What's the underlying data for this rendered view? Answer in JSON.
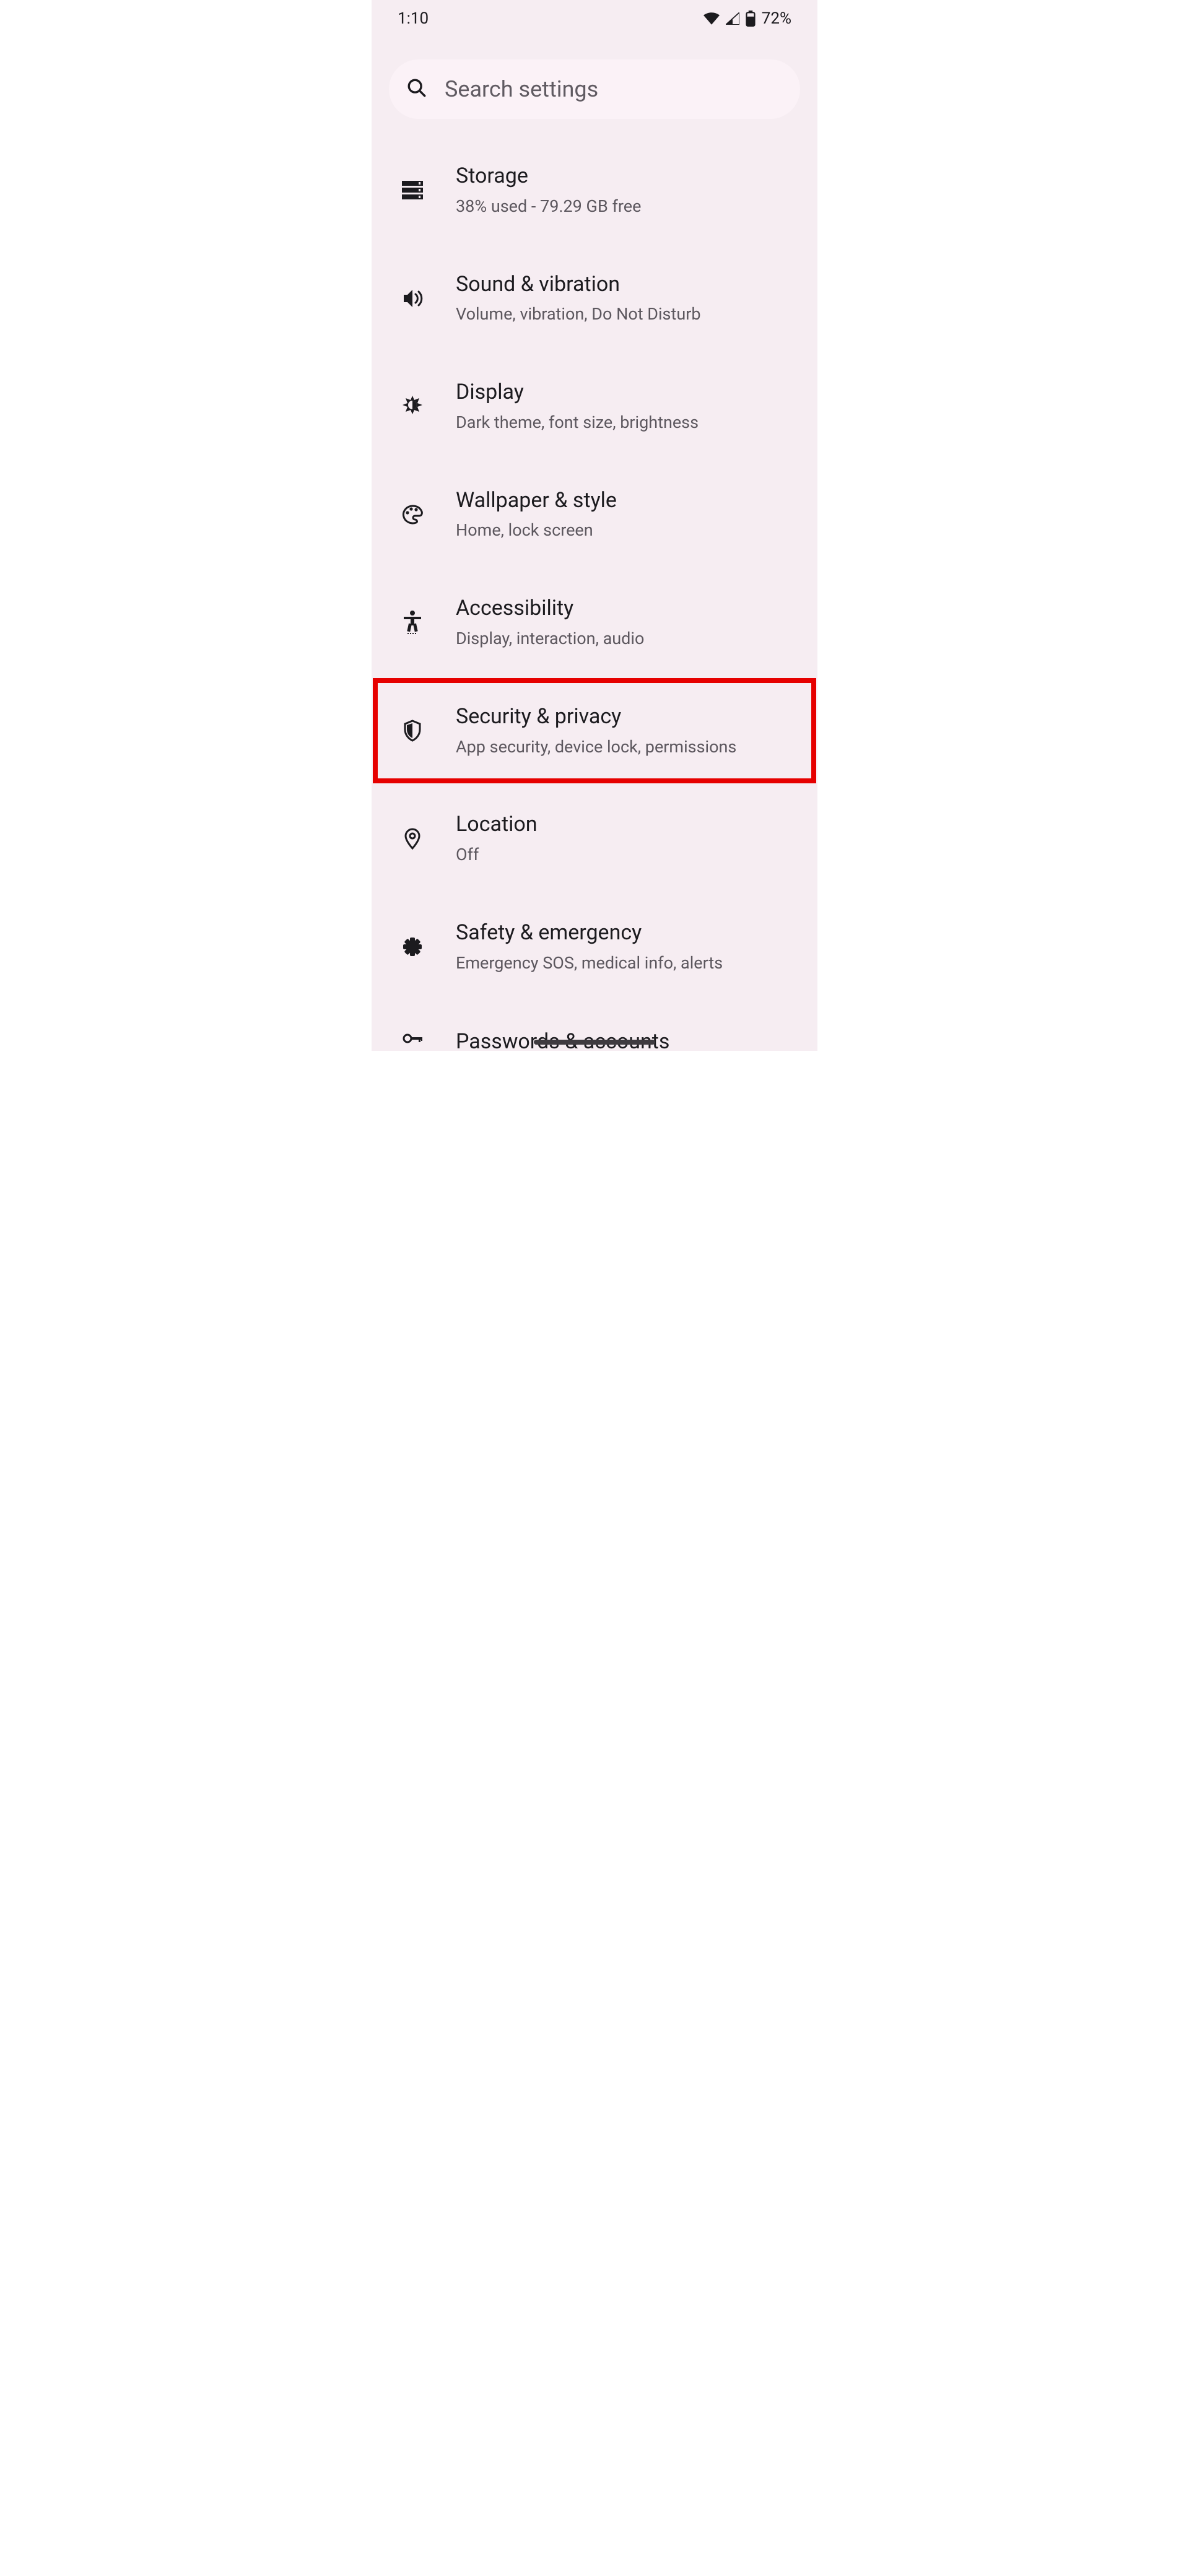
{
  "status": {
    "time": "1:10",
    "battery": "72%"
  },
  "search": {
    "placeholder": "Search settings"
  },
  "items": [
    {
      "title": "Storage",
      "subtitle": "38% used - 79.29 GB free"
    },
    {
      "title": "Sound & vibration",
      "subtitle": "Volume, vibration, Do Not Disturb"
    },
    {
      "title": "Display",
      "subtitle": "Dark theme, font size, brightness"
    },
    {
      "title": "Wallpaper & style",
      "subtitle": "Home, lock screen"
    },
    {
      "title": "Accessibility",
      "subtitle": "Display, interaction, audio"
    },
    {
      "title": "Security & privacy",
      "subtitle": "App security, device lock, permissions"
    },
    {
      "title": "Location",
      "subtitle": "Off"
    },
    {
      "title": "Safety & emergency",
      "subtitle": "Emergency SOS, medical info, alerts"
    },
    {
      "title": "Passwords & accounts",
      "subtitle": ""
    }
  ]
}
